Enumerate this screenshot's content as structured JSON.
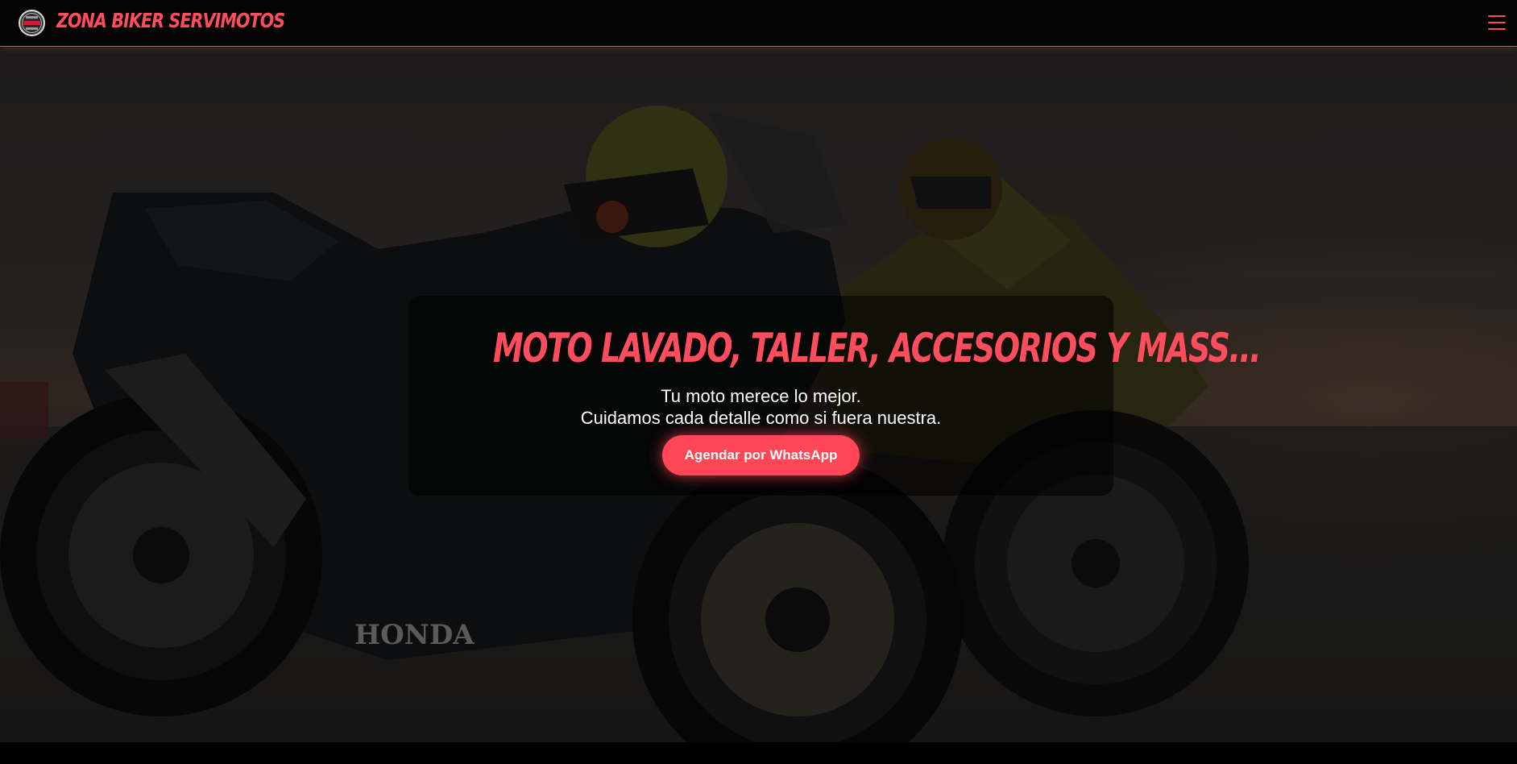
{
  "navbar": {
    "brand": "ZONA BIKER SERVIMOTOS",
    "logo_icon": "motorcycle-club-badge-icon",
    "menu_icon": "hamburger-menu-icon",
    "accent_color": "#ff4d5e"
  },
  "hero": {
    "title": "MOTO LAVADO, TALLER, ACCESORIOS Y MASS...",
    "line1": "Tu moto merece lo mejor.",
    "line2": "Cuidamos cada detalle como si fuera nuestra.",
    "cta_label": "Agendar por WhatsApp",
    "background": "two-sport-motorcycles-at-sunset",
    "bike_brand": "HONDA"
  }
}
